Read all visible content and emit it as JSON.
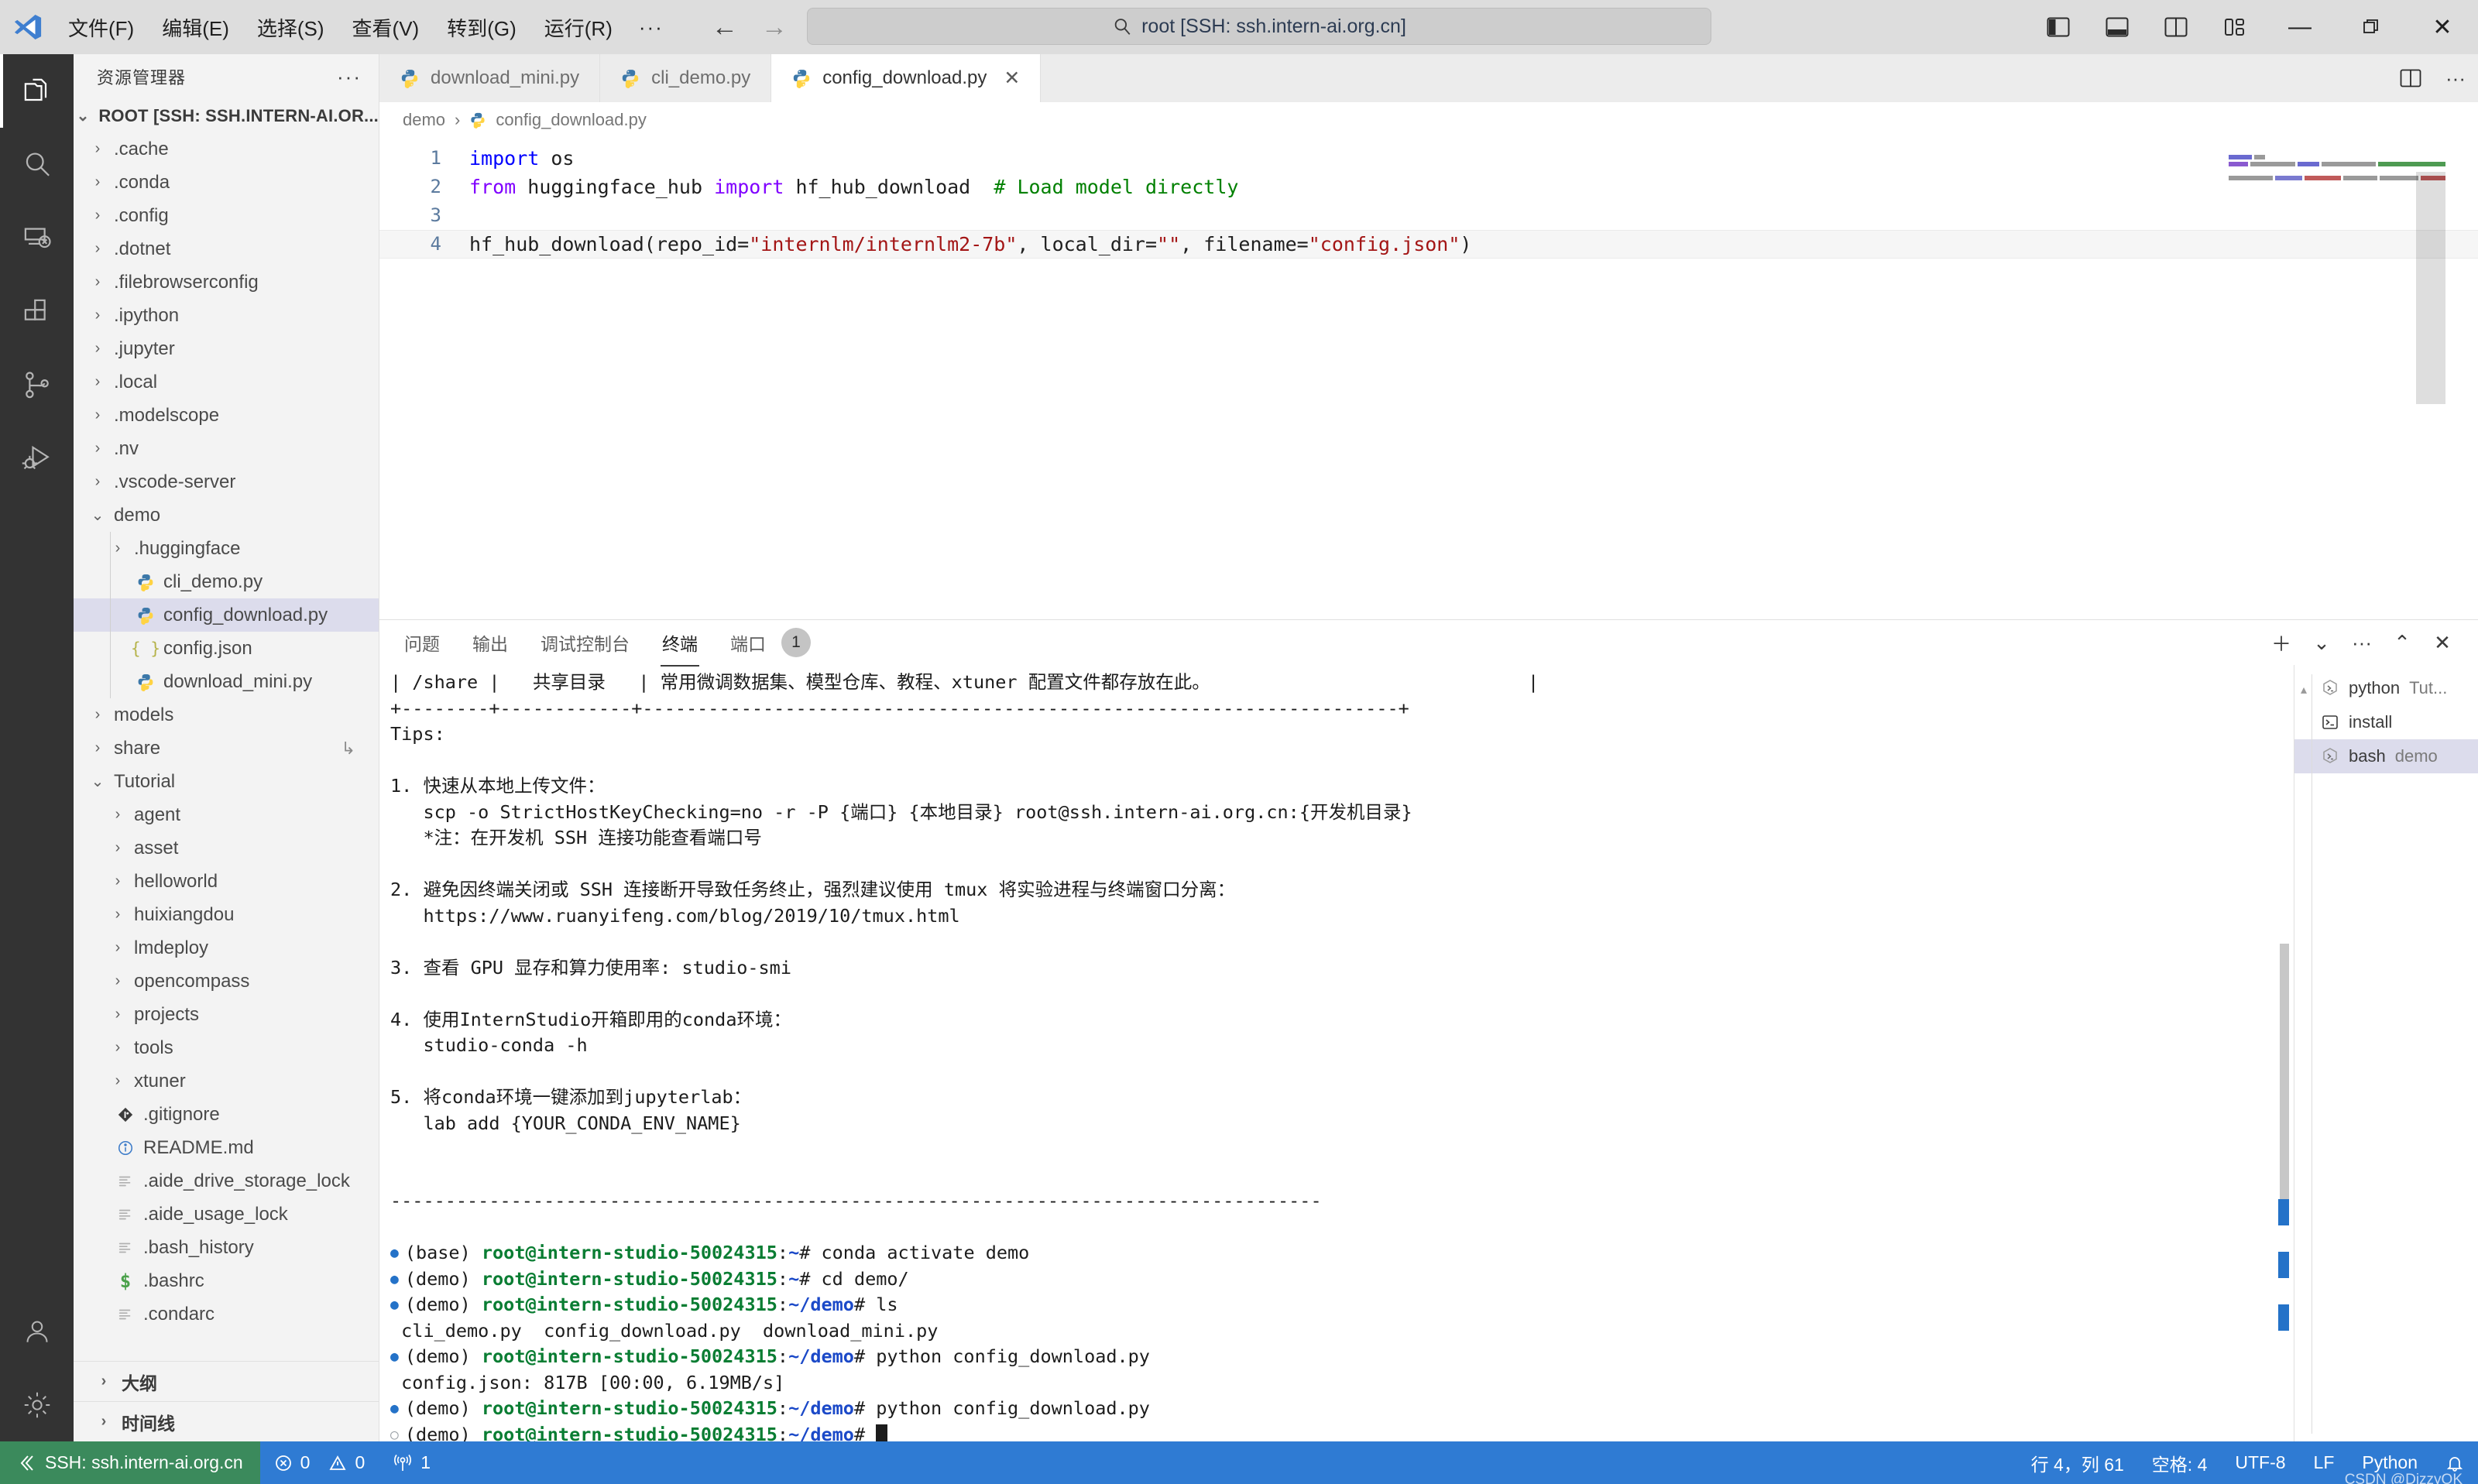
{
  "titlebar": {
    "logo_name": "vscode-logo",
    "menu": [
      "文件(F)",
      "编辑(E)",
      "选择(S)",
      "查看(V)",
      "转到(G)",
      "运行(R)"
    ],
    "menu_more": "···",
    "nav_back": "←",
    "nav_forward": "→",
    "search": {
      "icon": "search-icon",
      "text": "root [SSH: ssh.intern-ai.org.cn]"
    },
    "layout_buttons": [
      "toggle-primary-sidebar",
      "toggle-panel",
      "toggle-secondary-sidebar",
      "customize-layout"
    ],
    "window_controls": {
      "minimize": "—",
      "maximize": "❐",
      "close": "✕"
    }
  },
  "activitybar": {
    "items": [
      {
        "name": "explorer-icon",
        "active": true
      },
      {
        "name": "search-icon",
        "active": false
      },
      {
        "name": "remote-explorer-icon",
        "active": false
      },
      {
        "name": "extensions-icon",
        "active": false
      },
      {
        "name": "source-control-icon",
        "active": false
      },
      {
        "name": "run-and-debug-icon",
        "active": false
      }
    ],
    "bottom": [
      {
        "name": "accounts-icon"
      },
      {
        "name": "settings-gear-icon"
      }
    ]
  },
  "sidebar": {
    "title": "资源管理器",
    "more": "···",
    "root": "ROOT [SSH: SSH.INTERN-AI.OR...",
    "tree": [
      {
        "label": ".cache",
        "depth": 1,
        "kind": "folder",
        "expanded": false
      },
      {
        "label": ".conda",
        "depth": 1,
        "kind": "folder",
        "expanded": false
      },
      {
        "label": ".config",
        "depth": 1,
        "kind": "folder",
        "expanded": false
      },
      {
        "label": ".dotnet",
        "depth": 1,
        "kind": "folder",
        "expanded": false
      },
      {
        "label": ".filebrowserconfig",
        "depth": 1,
        "kind": "folder",
        "expanded": false
      },
      {
        "label": ".ipython",
        "depth": 1,
        "kind": "folder",
        "expanded": false
      },
      {
        "label": ".jupyter",
        "depth": 1,
        "kind": "folder",
        "expanded": false
      },
      {
        "label": ".local",
        "depth": 1,
        "kind": "folder",
        "expanded": false
      },
      {
        "label": ".modelscope",
        "depth": 1,
        "kind": "folder",
        "expanded": false
      },
      {
        "label": ".nv",
        "depth": 1,
        "kind": "folder",
        "expanded": false
      },
      {
        "label": ".vscode-server",
        "depth": 1,
        "kind": "folder",
        "expanded": false
      },
      {
        "label": "demo",
        "depth": 1,
        "kind": "folder",
        "expanded": true
      },
      {
        "label": ".huggingface",
        "depth": 2,
        "kind": "folder",
        "expanded": false,
        "guide": true
      },
      {
        "label": "cli_demo.py",
        "depth": 2,
        "kind": "python",
        "guide": true
      },
      {
        "label": "config_download.py",
        "depth": 2,
        "kind": "python",
        "guide": true,
        "selected": true
      },
      {
        "label": "config.json",
        "depth": 2,
        "kind": "json",
        "guide": true
      },
      {
        "label": "download_mini.py",
        "depth": 2,
        "kind": "python",
        "guide": true
      },
      {
        "label": "models",
        "depth": 1,
        "kind": "folder",
        "expanded": false
      },
      {
        "label": "share",
        "depth": 1,
        "kind": "folder",
        "expanded": false,
        "trailing": "↳"
      },
      {
        "label": "Tutorial",
        "depth": 1,
        "kind": "folder",
        "expanded": true
      },
      {
        "label": "agent",
        "depth": 2,
        "kind": "folder",
        "expanded": false
      },
      {
        "label": "asset",
        "depth": 2,
        "kind": "folder",
        "expanded": false
      },
      {
        "label": "helloworld",
        "depth": 2,
        "kind": "folder",
        "expanded": false
      },
      {
        "label": "huixiangdou",
        "depth": 2,
        "kind": "folder",
        "expanded": false
      },
      {
        "label": "lmdeploy",
        "depth": 2,
        "kind": "folder",
        "expanded": false
      },
      {
        "label": "opencompass",
        "depth": 2,
        "kind": "folder",
        "expanded": false
      },
      {
        "label": "projects",
        "depth": 2,
        "kind": "folder",
        "expanded": false
      },
      {
        "label": "tools",
        "depth": 2,
        "kind": "folder",
        "expanded": false
      },
      {
        "label": "xtuner",
        "depth": 2,
        "kind": "folder",
        "expanded": false
      },
      {
        "label": ".gitignore",
        "depth": 1,
        "kind": "git"
      },
      {
        "label": "README.md",
        "depth": 1,
        "kind": "info"
      },
      {
        "label": ".aide_drive_storage_lock",
        "depth": 1,
        "kind": "text"
      },
      {
        "label": ".aide_usage_lock",
        "depth": 1,
        "kind": "text"
      },
      {
        "label": ".bash_history",
        "depth": 1,
        "kind": "text"
      },
      {
        "label": ".bashrc",
        "depth": 1,
        "kind": "shell"
      },
      {
        "label": ".condarc",
        "depth": 1,
        "kind": "text"
      }
    ],
    "panels": [
      {
        "label": "大纲"
      },
      {
        "label": "时间线"
      }
    ]
  },
  "editor": {
    "tabs": [
      {
        "label": "download_mini.py",
        "icon": "python-icon",
        "active": false,
        "closable": false
      },
      {
        "label": "cli_demo.py",
        "icon": "python-icon",
        "active": false,
        "closable": false
      },
      {
        "label": "config_download.py",
        "icon": "python-icon",
        "active": true,
        "closable": true,
        "close": "✕"
      }
    ],
    "tab_actions": [
      "split-editor-icon",
      "editor-more-actions-icon"
    ],
    "breadcrumb": {
      "folder": "demo",
      "separator": "›",
      "file": "config_download.py",
      "icon": "python-icon"
    },
    "lines": [
      {
        "num": "1",
        "current": false
      },
      {
        "num": "2",
        "current": false
      },
      {
        "num": "3",
        "current": false
      },
      {
        "num": "4",
        "current": true
      }
    ],
    "code": {
      "l1_kw": "import",
      "l1_rest": " os",
      "l2_from": "from",
      "l2_mod": " huggingface_hub ",
      "l2_import": "import",
      "l2_name": " hf_hub_download  ",
      "l2_comment": "# Load model directly",
      "l4_fn": "hf_hub_download(repo_id=",
      "l4_s1": "\"internlm/internlm2-7b\"",
      "l4_m1": ", local_dir=",
      "l4_s2": "\"\"",
      "l4_m2": ", filename=",
      "l4_s3": "\"config.json\"",
      "l4_end": ")"
    }
  },
  "panel": {
    "tabs": [
      {
        "label": "问题",
        "active": false
      },
      {
        "label": "输出",
        "active": false
      },
      {
        "label": "调试控制台",
        "active": false
      },
      {
        "label": "终端",
        "active": true
      },
      {
        "label": "端口",
        "active": false
      }
    ],
    "port_badge": "1",
    "actions": [
      {
        "name": "new-terminal-icon",
        "glyph": "＋"
      },
      {
        "name": "terminal-dropdown-icon",
        "glyph": "⌄"
      },
      {
        "name": "panel-more-actions-icon",
        "glyph": "···"
      },
      {
        "name": "maximize-panel-icon",
        "glyph": "⌃"
      },
      {
        "name": "close-panel-icon",
        "glyph": "✕"
      }
    ],
    "terminal_list": [
      {
        "label": "python",
        "sub": "Tut...",
        "icon": "powershell-icon",
        "active": false
      },
      {
        "label": "install",
        "sub": "",
        "icon": "terminal-bash-icon",
        "active": false
      },
      {
        "label": "bash",
        "sub": "demo",
        "icon": "powershell-icon",
        "active": true
      }
    ],
    "terminal_lines": [
      {
        "t": "plain",
        "text": "| /share |   共享目录   | 常用微调数据集、模型仓库、教程、xtuner 配置文件都存放在此。                             |"
      },
      {
        "t": "plain",
        "text": "+--------+------------+---------------------------------------------------------------------+"
      },
      {
        "t": "plain",
        "text": "Tips:"
      },
      {
        "t": "plain",
        "text": ""
      },
      {
        "t": "plain",
        "text": "1. 快速从本地上传文件："
      },
      {
        "t": "plain",
        "text": "   scp -o StrictHostKeyChecking=no -r -P {端口} {本地目录} root@ssh.intern-ai.org.cn:{开发机目录}"
      },
      {
        "t": "plain",
        "text": "   *注：在开发机 SSH 连接功能查看端口号"
      },
      {
        "t": "plain",
        "text": ""
      },
      {
        "t": "plain",
        "text": "2. 避免因终端关闭或 SSH 连接断开导致任务终止，强烈建议使用 tmux 将实验进程与终端窗口分离："
      },
      {
        "t": "plain",
        "text": "   https://www.ruanyifeng.com/blog/2019/10/tmux.html"
      },
      {
        "t": "plain",
        "text": ""
      },
      {
        "t": "plain",
        "text": "3. 查看 GPU 显存和算力使用率: studio-smi"
      },
      {
        "t": "plain",
        "text": ""
      },
      {
        "t": "plain",
        "text": "4. 使用InternStudio开箱即用的conda环境："
      },
      {
        "t": "plain",
        "text": "   studio-conda -h"
      },
      {
        "t": "plain",
        "text": ""
      },
      {
        "t": "plain",
        "text": "5. 将conda环境一键添加到jupyterlab："
      },
      {
        "t": "plain",
        "text": "   lab add {YOUR_CONDA_ENV_NAME}"
      },
      {
        "t": "plain",
        "text": ""
      },
      {
        "t": "plain",
        "text": ""
      },
      {
        "t": "plain",
        "text": "-------------------------------------------------------------------------------------"
      },
      {
        "t": "plain",
        "text": ""
      },
      {
        "t": "prompt",
        "dot": "solid",
        "env": "(base) ",
        "user": "root@intern-studio-50024315",
        "colon": ":",
        "path": "~",
        "hash": "# ",
        "cmd": "conda activate demo"
      },
      {
        "t": "prompt",
        "dot": "solid",
        "env": "(demo) ",
        "user": "root@intern-studio-50024315",
        "colon": ":",
        "path": "~",
        "hash": "# ",
        "cmd": "cd demo/"
      },
      {
        "t": "prompt",
        "dot": "solid",
        "env": "(demo) ",
        "user": "root@intern-studio-50024315",
        "colon": ":",
        "path": "~/demo",
        "hash": "# ",
        "cmd": "ls"
      },
      {
        "t": "plain",
        "text": " cli_demo.py  config_download.py  download_mini.py"
      },
      {
        "t": "prompt",
        "dot": "solid",
        "env": "(demo) ",
        "user": "root@intern-studio-50024315",
        "colon": ":",
        "path": "~/demo",
        "hash": "# ",
        "cmd": "python config_download.py"
      },
      {
        "t": "plain",
        "text": " config.json: 817B [00:00, 6.19MB/s]"
      },
      {
        "t": "prompt",
        "dot": "solid",
        "env": "(demo) ",
        "user": "root@intern-studio-50024315",
        "colon": ":",
        "path": "~/demo",
        "hash": "# ",
        "cmd": "python config_download.py"
      },
      {
        "t": "prompt",
        "dot": "hollow",
        "env": "(demo) ",
        "user": "root@intern-studio-50024315",
        "colon": ":",
        "path": "~/demo",
        "hash": "# ",
        "cmd": "",
        "cursor": true
      }
    ]
  },
  "statusbar": {
    "remote": {
      "icon": "remote-ssh-icon",
      "label": "SSH: ssh.intern-ai.org.cn"
    },
    "errors": {
      "icon": "error-icon",
      "count": "0"
    },
    "warnings": {
      "icon": "warning-icon",
      "count": "0"
    },
    "ports": {
      "icon": "radio-tower-icon",
      "count": "1"
    },
    "right": [
      {
        "name": "editor-position",
        "label": "行 4，列 61"
      },
      {
        "name": "indentation",
        "label": "空格: 4"
      },
      {
        "name": "encoding",
        "label": "UTF-8"
      },
      {
        "name": "eol",
        "label": "LF"
      },
      {
        "name": "language-mode",
        "label": "Python"
      }
    ],
    "bell": "bell-icon",
    "watermark": "CSDN @DizzyOK"
  },
  "colors": {
    "accent_blue": "#2f7bd3",
    "remote_green": "#3b8a5c",
    "selection": "#dcdcec",
    "titlebar": "#dddddd",
    "activitybar": "#333333",
    "sidebar": "#f3f3f3",
    "terminal_green": "#0a7d33",
    "terminal_blue": "#1b49c8"
  }
}
